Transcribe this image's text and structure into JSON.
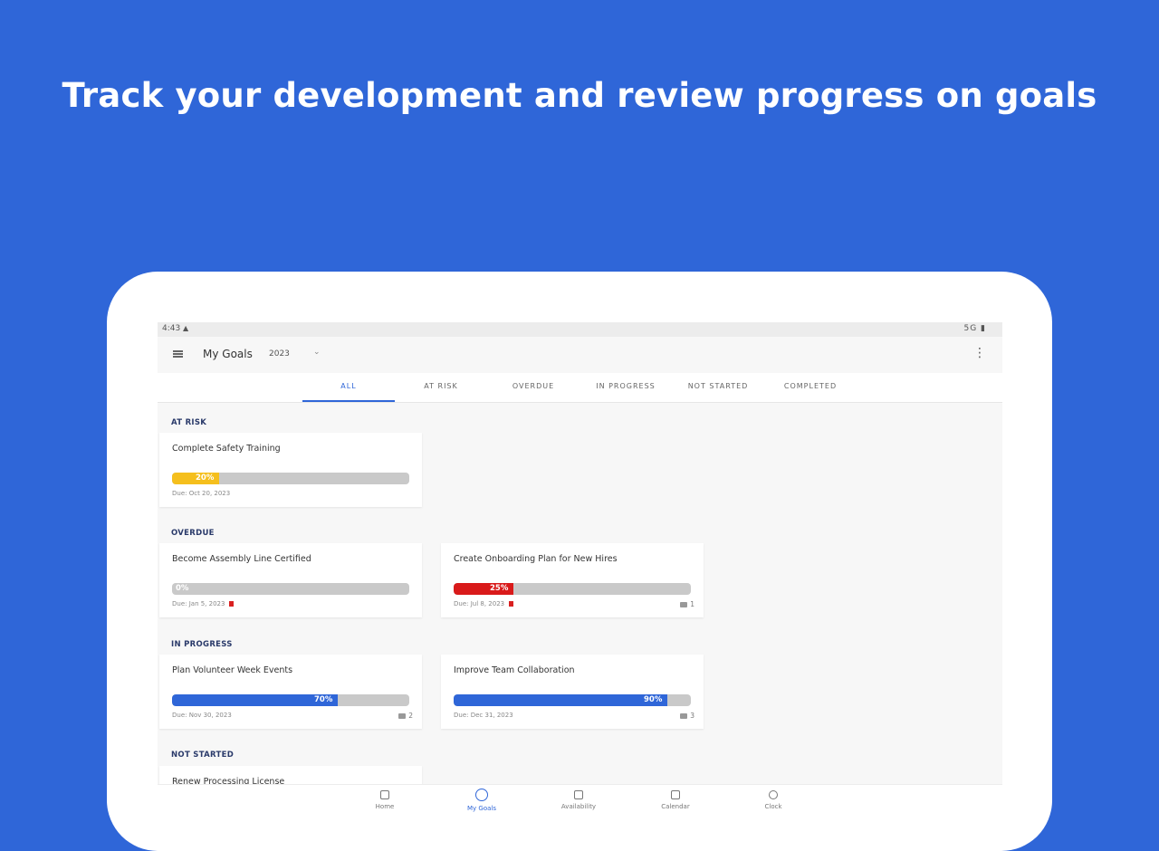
{
  "headline": "Track your development and review progress on goals",
  "statusbar": {
    "time": "4:43",
    "alert_icon": "warning-icon",
    "right": "5G ▮"
  },
  "appbar": {
    "title": "My Goals",
    "year": "2023",
    "chevron": "⌄",
    "kebab": "⋮"
  },
  "tabs": [
    {
      "label": "ALL",
      "active": true
    },
    {
      "label": "AT RISK",
      "active": false
    },
    {
      "label": "OVERDUE",
      "active": false
    },
    {
      "label": "IN PROGRESS",
      "active": false
    },
    {
      "label": "NOT STARTED",
      "active": false
    },
    {
      "label": "COMPLETED",
      "active": false
    }
  ],
  "sections": {
    "at_risk": "AT RISK",
    "overdue": "OVERDUE",
    "in_progress": "IN PROGRESS",
    "not_started": "NOT STARTED"
  },
  "cards": [
    {
      "title": "Complete Safety Training",
      "progress": 20,
      "progress_label": "20%",
      "color": "#f5bf1d",
      "due": "Due: Oct 20, 2023",
      "flag": false,
      "comments": ""
    },
    {
      "title": "Become Assembly Line Certified",
      "progress": 0,
      "progress_label": "0%",
      "color": "#c9c9c9",
      "due": "Due: Jan 5, 2023",
      "flag": true,
      "comments": ""
    },
    {
      "title": "Create Onboarding Plan for New Hires",
      "progress": 25,
      "progress_label": "25%",
      "color": "#d91a1a",
      "due": "Due: Jul 8, 2023",
      "flag": true,
      "comments": "1"
    },
    {
      "title": "Plan Volunteer Week Events",
      "progress": 70,
      "progress_label": "70%",
      "color": "#2f66d8",
      "due": "Due: Nov 30, 2023",
      "flag": false,
      "comments": "2"
    },
    {
      "title": "Improve Team Collaboration",
      "progress": 90,
      "progress_label": "90%",
      "color": "#2f66d8",
      "due": "Due: Dec 31, 2023",
      "flag": false,
      "comments": "3"
    },
    {
      "title": "Renew Processing License"
    }
  ],
  "nav": [
    {
      "label": "Home",
      "icon": "home-icon"
    },
    {
      "label": "My Goals",
      "icon": "goals-icon"
    },
    {
      "label": "Availability",
      "icon": "availability-icon"
    },
    {
      "label": "Calendar",
      "icon": "calendar-icon"
    },
    {
      "label": "Clock",
      "icon": "clock-icon"
    }
  ],
  "colors": {
    "brand": "#2f66d8",
    "at_risk": "#f5bf1d",
    "overdue": "#d91a1a",
    "track": "#c9c9c9"
  }
}
